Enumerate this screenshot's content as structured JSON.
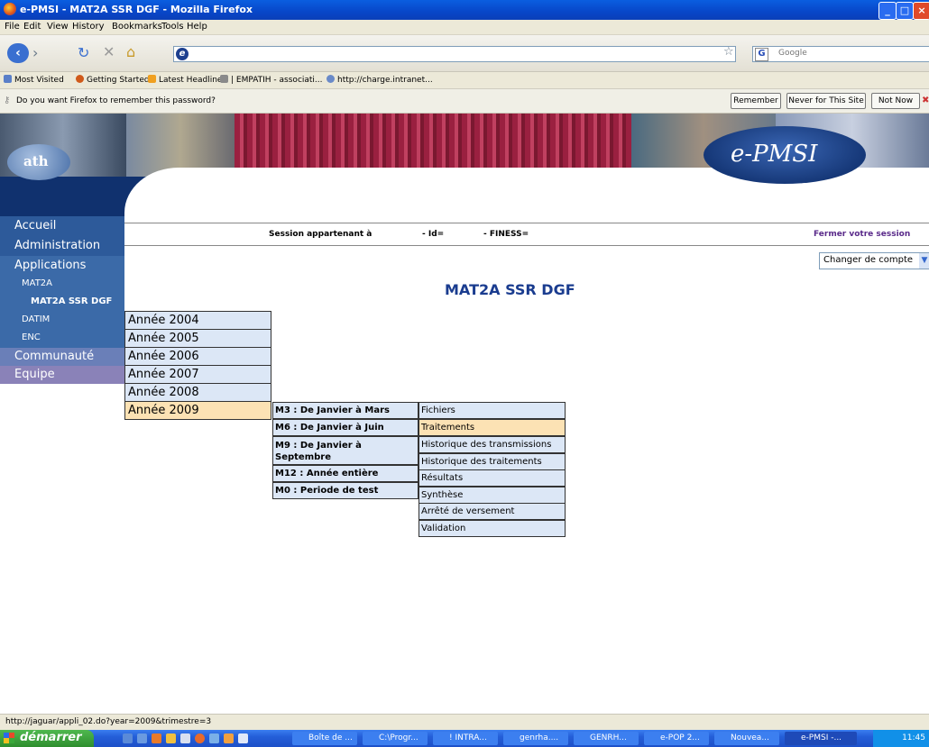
{
  "window": {
    "title": "e-PMSI - MAT2A SSR DGF - Mozilla Firefox",
    "buttons": [
      "_",
      "□",
      "×"
    ]
  },
  "menubar": [
    "File",
    "Edit",
    "View",
    "History",
    "Bookmarks",
    "Tools",
    "Help"
  ],
  "urlbar": {
    "value": ""
  },
  "search": {
    "placeholder": "Google"
  },
  "bookmarks": [
    "Most Visited",
    "Getting Started",
    "Latest Headlines",
    "| EMPATIH - associati...",
    "http://charge.intranet..."
  ],
  "password_bar": {
    "message": "Do you want Firefox to remember this password?",
    "remember": "Remember",
    "never": "Never for This Site",
    "not_now": "Not Now"
  },
  "header": {
    "logo_text": "e-PMSI",
    "ath": "ath"
  },
  "sidebar": [
    {
      "label": "Accueil",
      "level": "big",
      "color": "#2d5a9a"
    },
    {
      "label": "Administration",
      "level": "big",
      "color": "#2d5a9a"
    },
    {
      "label": "Applications",
      "level": "big",
      "color": "#3b6aa8"
    },
    {
      "label": "MAT2A",
      "level": "sub",
      "color": "#3b6aa8"
    },
    {
      "label": "MAT2A SSR DGF",
      "level": "subsub",
      "color": "#3b6aa8"
    },
    {
      "label": "DATIM",
      "level": "sub",
      "color": "#3b6aa8"
    },
    {
      "label": "ENC",
      "level": "sub",
      "color": "#3b6aa8"
    },
    {
      "label": "Communauté",
      "level": "big",
      "color": "#6a7fb8"
    },
    {
      "label": "Equipe",
      "level": "big",
      "color": "#8a82b8"
    }
  ],
  "session": {
    "owner": "Session appartenant à",
    "id": "- Id=",
    "finess": "- FINESS=",
    "logout": "Fermer votre session"
  },
  "account_select": {
    "value": "Changer de compte"
  },
  "page_title": "MAT2A SSR DGF",
  "years": [
    "Année 2004",
    "Année 2005",
    "Année 2006",
    "Année 2007",
    "Année 2008",
    "Année 2009"
  ],
  "selected_year": "Année 2009",
  "periods": [
    "M3 : De Janvier à Mars",
    "M6 : De Janvier à Juin",
    "M9 : De Janvier à Septembre",
    "M12 : Année entière",
    "M0 : Periode de test"
  ],
  "actions": [
    "Fichiers",
    "Traitements",
    "Historique des transmissions",
    "Historique des traitements",
    "Résultats",
    "Synthèse",
    "Arrêté de versement",
    "Validation"
  ],
  "highlight_color": "#fce2b4",
  "status_url": "http://jaguar/appli_02.do?year=2009&trimestre=3",
  "taskbar": {
    "start": "démarrer",
    "tasks": [
      "Boîte de ...",
      "C:\\Progr...",
      "! INTRA...",
      "genrha....",
      "GENRH...",
      "e-POP 2...",
      "Nouvea...",
      "e-PMSI -..."
    ],
    "active": "e-PMSI -...",
    "clock": "11:45"
  }
}
